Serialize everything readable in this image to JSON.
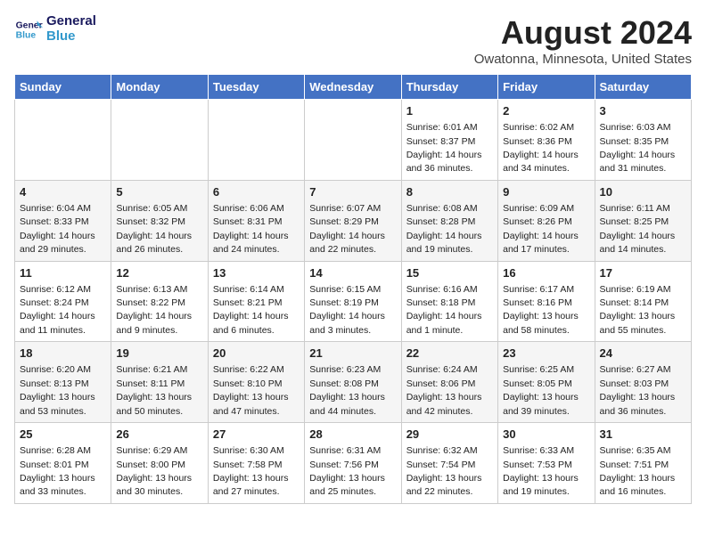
{
  "header": {
    "logo_line1": "General",
    "logo_line2": "Blue",
    "main_title": "August 2024",
    "subtitle": "Owatonna, Minnesota, United States"
  },
  "days_of_week": [
    "Sunday",
    "Monday",
    "Tuesday",
    "Wednesday",
    "Thursday",
    "Friday",
    "Saturday"
  ],
  "weeks": [
    [
      {
        "day": "",
        "info": ""
      },
      {
        "day": "",
        "info": ""
      },
      {
        "day": "",
        "info": ""
      },
      {
        "day": "",
        "info": ""
      },
      {
        "day": "1",
        "info": "Sunrise: 6:01 AM\nSunset: 8:37 PM\nDaylight: 14 hours\nand 36 minutes."
      },
      {
        "day": "2",
        "info": "Sunrise: 6:02 AM\nSunset: 8:36 PM\nDaylight: 14 hours\nand 34 minutes."
      },
      {
        "day": "3",
        "info": "Sunrise: 6:03 AM\nSunset: 8:35 PM\nDaylight: 14 hours\nand 31 minutes."
      }
    ],
    [
      {
        "day": "4",
        "info": "Sunrise: 6:04 AM\nSunset: 8:33 PM\nDaylight: 14 hours\nand 29 minutes."
      },
      {
        "day": "5",
        "info": "Sunrise: 6:05 AM\nSunset: 8:32 PM\nDaylight: 14 hours\nand 26 minutes."
      },
      {
        "day": "6",
        "info": "Sunrise: 6:06 AM\nSunset: 8:31 PM\nDaylight: 14 hours\nand 24 minutes."
      },
      {
        "day": "7",
        "info": "Sunrise: 6:07 AM\nSunset: 8:29 PM\nDaylight: 14 hours\nand 22 minutes."
      },
      {
        "day": "8",
        "info": "Sunrise: 6:08 AM\nSunset: 8:28 PM\nDaylight: 14 hours\nand 19 minutes."
      },
      {
        "day": "9",
        "info": "Sunrise: 6:09 AM\nSunset: 8:26 PM\nDaylight: 14 hours\nand 17 minutes."
      },
      {
        "day": "10",
        "info": "Sunrise: 6:11 AM\nSunset: 8:25 PM\nDaylight: 14 hours\nand 14 minutes."
      }
    ],
    [
      {
        "day": "11",
        "info": "Sunrise: 6:12 AM\nSunset: 8:24 PM\nDaylight: 14 hours\nand 11 minutes."
      },
      {
        "day": "12",
        "info": "Sunrise: 6:13 AM\nSunset: 8:22 PM\nDaylight: 14 hours\nand 9 minutes."
      },
      {
        "day": "13",
        "info": "Sunrise: 6:14 AM\nSunset: 8:21 PM\nDaylight: 14 hours\nand 6 minutes."
      },
      {
        "day": "14",
        "info": "Sunrise: 6:15 AM\nSunset: 8:19 PM\nDaylight: 14 hours\nand 3 minutes."
      },
      {
        "day": "15",
        "info": "Sunrise: 6:16 AM\nSunset: 8:18 PM\nDaylight: 14 hours\nand 1 minute."
      },
      {
        "day": "16",
        "info": "Sunrise: 6:17 AM\nSunset: 8:16 PM\nDaylight: 13 hours\nand 58 minutes."
      },
      {
        "day": "17",
        "info": "Sunrise: 6:19 AM\nSunset: 8:14 PM\nDaylight: 13 hours\nand 55 minutes."
      }
    ],
    [
      {
        "day": "18",
        "info": "Sunrise: 6:20 AM\nSunset: 8:13 PM\nDaylight: 13 hours\nand 53 minutes."
      },
      {
        "day": "19",
        "info": "Sunrise: 6:21 AM\nSunset: 8:11 PM\nDaylight: 13 hours\nand 50 minutes."
      },
      {
        "day": "20",
        "info": "Sunrise: 6:22 AM\nSunset: 8:10 PM\nDaylight: 13 hours\nand 47 minutes."
      },
      {
        "day": "21",
        "info": "Sunrise: 6:23 AM\nSunset: 8:08 PM\nDaylight: 13 hours\nand 44 minutes."
      },
      {
        "day": "22",
        "info": "Sunrise: 6:24 AM\nSunset: 8:06 PM\nDaylight: 13 hours\nand 42 minutes."
      },
      {
        "day": "23",
        "info": "Sunrise: 6:25 AM\nSunset: 8:05 PM\nDaylight: 13 hours\nand 39 minutes."
      },
      {
        "day": "24",
        "info": "Sunrise: 6:27 AM\nSunset: 8:03 PM\nDaylight: 13 hours\nand 36 minutes."
      }
    ],
    [
      {
        "day": "25",
        "info": "Sunrise: 6:28 AM\nSunset: 8:01 PM\nDaylight: 13 hours\nand 33 minutes."
      },
      {
        "day": "26",
        "info": "Sunrise: 6:29 AM\nSunset: 8:00 PM\nDaylight: 13 hours\nand 30 minutes."
      },
      {
        "day": "27",
        "info": "Sunrise: 6:30 AM\nSunset: 7:58 PM\nDaylight: 13 hours\nand 27 minutes."
      },
      {
        "day": "28",
        "info": "Sunrise: 6:31 AM\nSunset: 7:56 PM\nDaylight: 13 hours\nand 25 minutes."
      },
      {
        "day": "29",
        "info": "Sunrise: 6:32 AM\nSunset: 7:54 PM\nDaylight: 13 hours\nand 22 minutes."
      },
      {
        "day": "30",
        "info": "Sunrise: 6:33 AM\nSunset: 7:53 PM\nDaylight: 13 hours\nand 19 minutes."
      },
      {
        "day": "31",
        "info": "Sunrise: 6:35 AM\nSunset: 7:51 PM\nDaylight: 13 hours\nand 16 minutes."
      }
    ]
  ]
}
